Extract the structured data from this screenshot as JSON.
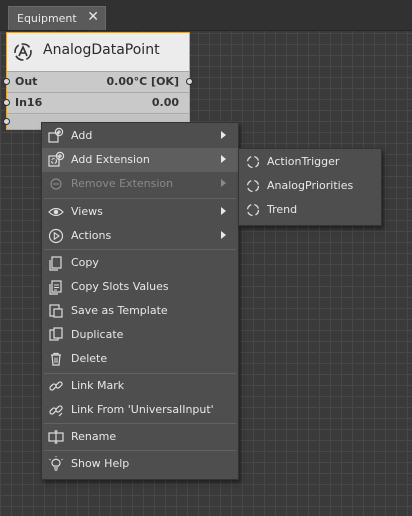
{
  "tab": {
    "title": "Equipment",
    "close_glyph": "✕"
  },
  "component": {
    "name": "AnalogDataPoint",
    "icon": "analog-point-icon",
    "slots": [
      {
        "label": "Out",
        "value": "0.00°C [OK]"
      },
      {
        "label": "In16",
        "value": "0.00"
      }
    ],
    "border_color": "#d9a441"
  },
  "context_menu": {
    "items": [
      {
        "label": "Add",
        "icon": "add-icon",
        "submenu": true
      },
      {
        "label": "Add Extension",
        "icon": "add-extension-icon",
        "submenu": true,
        "active": true
      },
      {
        "label": "Remove Extension",
        "icon": "remove-icon",
        "submenu": true,
        "disabled": true
      },
      {
        "label": "Views",
        "icon": "eye-icon",
        "submenu": true
      },
      {
        "label": "Actions",
        "icon": "play-circle-icon",
        "submenu": true
      },
      {
        "label": "Copy",
        "icon": "copy-icon"
      },
      {
        "label": "Copy Slots Values",
        "icon": "copy-slots-icon"
      },
      {
        "label": "Save as Template",
        "icon": "template-icon"
      },
      {
        "label": "Duplicate",
        "icon": "duplicate-icon"
      },
      {
        "label": "Delete",
        "icon": "trash-icon"
      },
      {
        "label": "Link Mark",
        "icon": "link-icon"
      },
      {
        "label": "Link From 'UniversalInput'",
        "icon": "link-from-icon"
      },
      {
        "label": "Rename",
        "icon": "rename-icon"
      },
      {
        "label": "Show Help",
        "icon": "lightbulb-icon"
      }
    ]
  },
  "submenu": {
    "items": [
      {
        "label": "ActionTrigger",
        "icon": "extension-icon"
      },
      {
        "label": "AnalogPriorities",
        "icon": "extension-icon"
      },
      {
        "label": "Trend",
        "icon": "extension-icon"
      }
    ]
  }
}
